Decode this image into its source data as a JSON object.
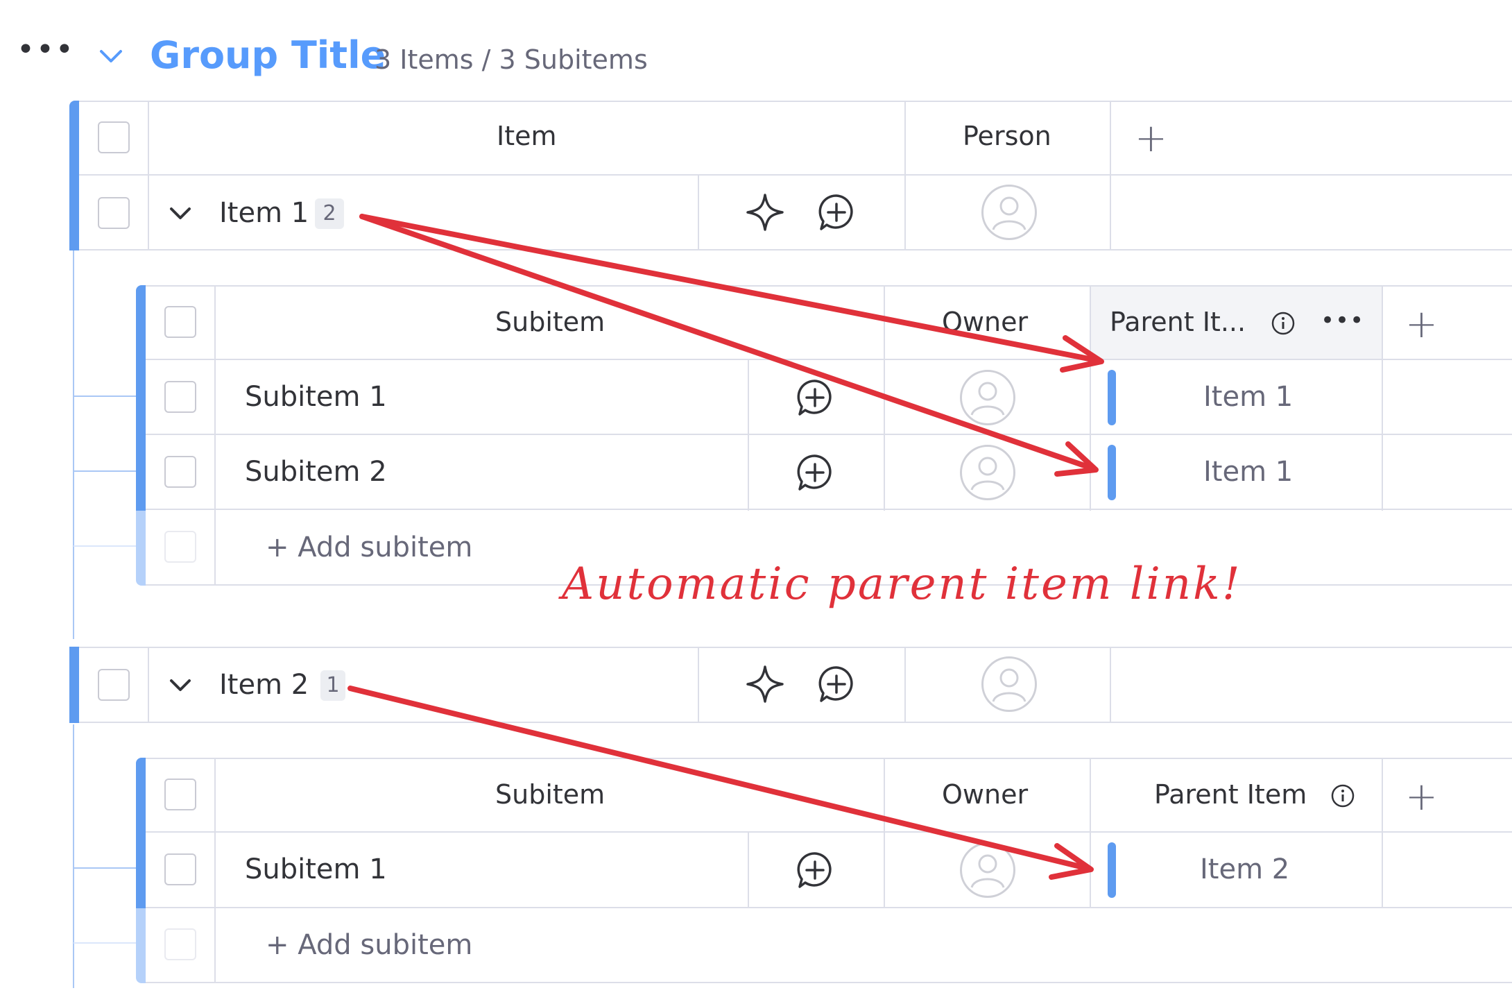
{
  "group": {
    "title": "Group Title",
    "summary": "3 Items / 3 Subitems",
    "accent": "#579bfc",
    "columns": {
      "item": "Item",
      "person": "Person"
    },
    "add_column_icon": "plus-icon",
    "menu_icon": "more-dots-icon",
    "collapse_icon": "chevron-down-icon"
  },
  "items": [
    {
      "name": "Item 1",
      "subitem_count": "2",
      "subtable": {
        "col_subitem": "Subitem",
        "col_owner": "Owner",
        "col_parent": "Parent It...",
        "rows": [
          {
            "name": "Subitem 1",
            "parent": "Item 1"
          },
          {
            "name": "Subitem 2",
            "parent": "Item 1"
          }
        ],
        "add_label": "+ Add subitem"
      }
    },
    {
      "name": "Item 2",
      "subitem_count": "1",
      "subtable": {
        "col_subitem": "Subitem",
        "col_owner": "Owner",
        "col_parent": "Parent Item",
        "rows": [
          {
            "name": "Subitem 1",
            "parent": "Item 2"
          }
        ],
        "add_label": "+ Add subitem"
      }
    }
  ],
  "annotation": {
    "text": "Automatic parent item link!",
    "color": "#e0313a"
  }
}
